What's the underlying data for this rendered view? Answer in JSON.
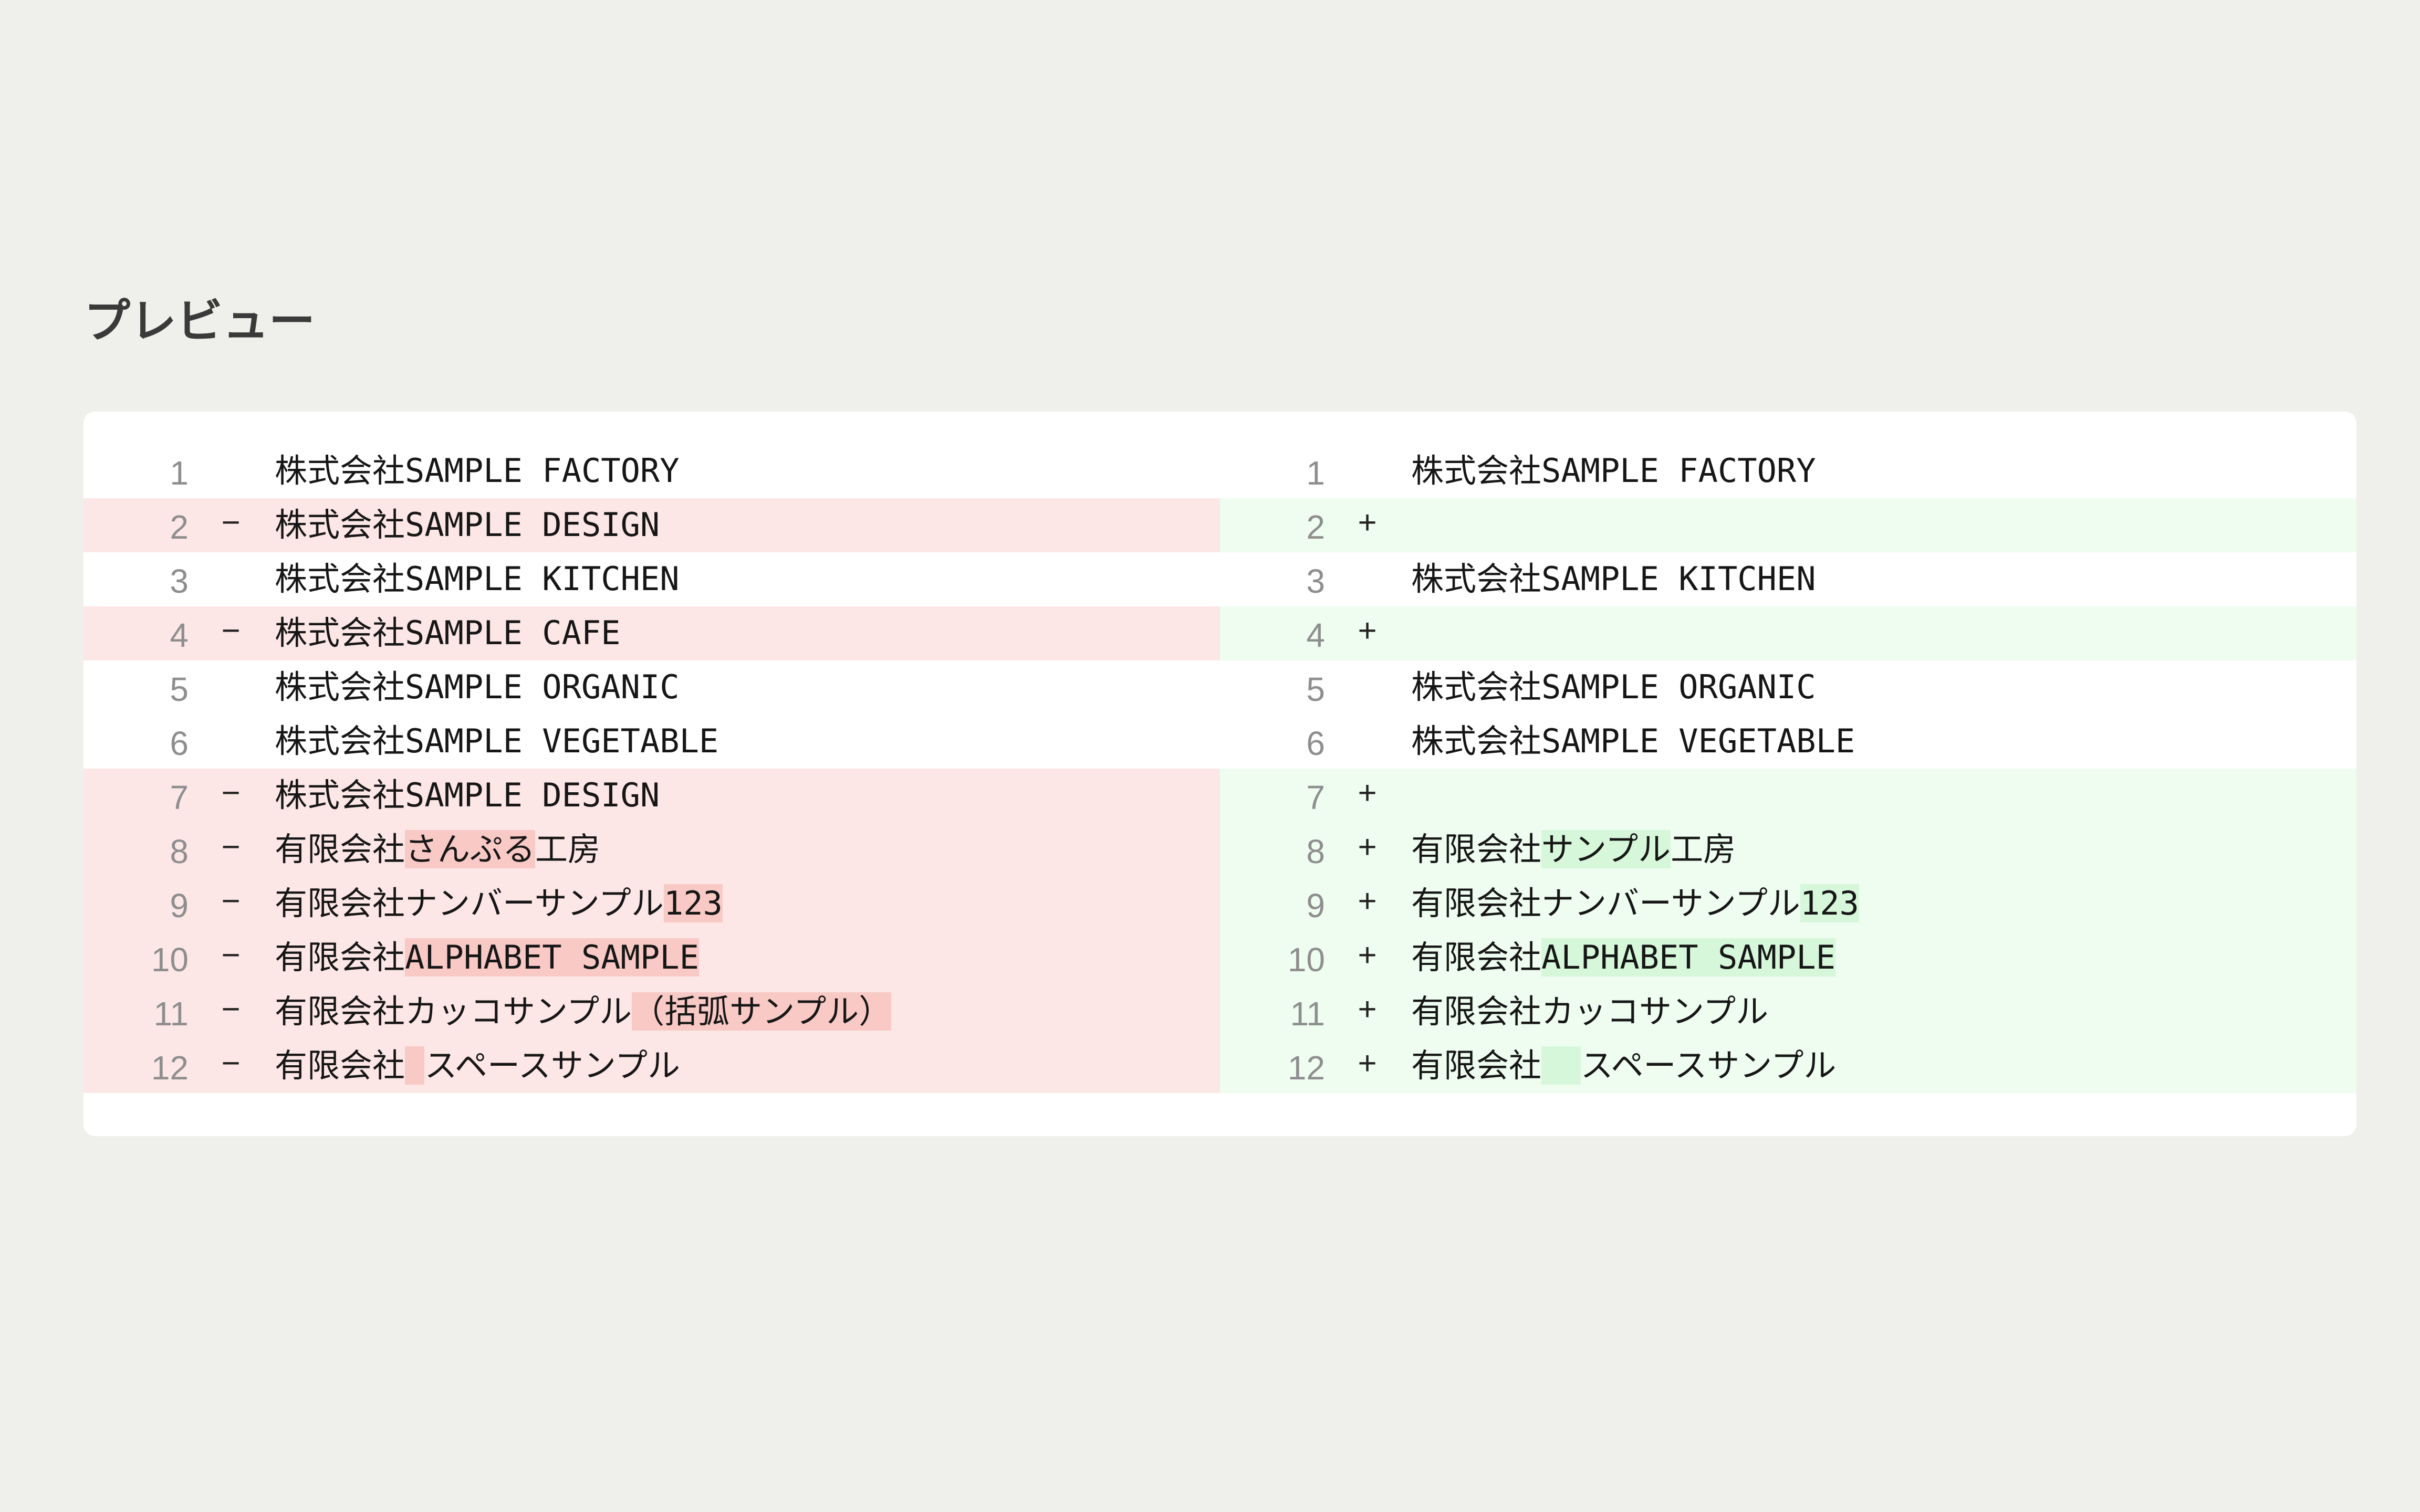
{
  "page": {
    "title": "プレビュー"
  },
  "colors": {
    "background": "#efefeb",
    "card": "#ffffff",
    "removed_row": "#fde7e6",
    "removed_highlight": "#f8c9c5",
    "added_row": "#eefdf0",
    "added_highlight": "#d6f7da",
    "line_number": "#8e8e8e"
  },
  "diff": {
    "left": [
      {
        "num": "1",
        "marker": "",
        "type": "same",
        "segments": [
          {
            "text": "株式会社SAMPLE FACTORY",
            "hl": false
          }
        ]
      },
      {
        "num": "2",
        "marker": "−",
        "type": "del",
        "segments": [
          {
            "text": "株式会社SAMPLE DESIGN",
            "hl": false
          }
        ]
      },
      {
        "num": "3",
        "marker": "",
        "type": "same",
        "segments": [
          {
            "text": "株式会社SAMPLE KITCHEN",
            "hl": false
          }
        ]
      },
      {
        "num": "4",
        "marker": "−",
        "type": "del",
        "segments": [
          {
            "text": "株式会社SAMPLE CAFE",
            "hl": false
          }
        ]
      },
      {
        "num": "5",
        "marker": "",
        "type": "same",
        "segments": [
          {
            "text": "株式会社SAMPLE ORGANIC",
            "hl": false
          }
        ]
      },
      {
        "num": "6",
        "marker": "",
        "type": "same",
        "segments": [
          {
            "text": "株式会社SAMPLE VEGETABLE",
            "hl": false
          }
        ]
      },
      {
        "num": "7",
        "marker": "−",
        "type": "del",
        "segments": [
          {
            "text": "株式会社SAMPLE DESIGN",
            "hl": false
          }
        ]
      },
      {
        "num": "8",
        "marker": "−",
        "type": "del",
        "segments": [
          {
            "text": "有限会社",
            "hl": false
          },
          {
            "text": "さんぷる",
            "hl": true
          },
          {
            "text": "工房",
            "hl": false
          }
        ]
      },
      {
        "num": "9",
        "marker": "−",
        "type": "del",
        "segments": [
          {
            "text": "有限会社ナンバーサンプル",
            "hl": false
          },
          {
            "text": "123",
            "hl": true
          }
        ]
      },
      {
        "num": "10",
        "marker": "−",
        "type": "del",
        "segments": [
          {
            "text": "有限会社",
            "hl": false
          },
          {
            "text": "ALPHABET SAMPLE",
            "hl": true
          }
        ]
      },
      {
        "num": "11",
        "marker": "−",
        "type": "del",
        "segments": [
          {
            "text": "有限会社カッコサンプル",
            "hl": false
          },
          {
            "text": "（括弧サンプル）",
            "hl": true
          }
        ]
      },
      {
        "num": "12",
        "marker": "−",
        "type": "del",
        "segments": [
          {
            "text": "有限会社",
            "hl": false
          },
          {
            "text": " ",
            "hl": true
          },
          {
            "text": "スペースサンプル",
            "hl": false
          }
        ]
      }
    ],
    "right": [
      {
        "num": "1",
        "marker": "",
        "type": "same",
        "segments": [
          {
            "text": "株式会社SAMPLE FACTORY",
            "hl": false
          }
        ]
      },
      {
        "num": "2",
        "marker": "+",
        "type": "add",
        "segments": []
      },
      {
        "num": "3",
        "marker": "",
        "type": "same",
        "segments": [
          {
            "text": "株式会社SAMPLE KITCHEN",
            "hl": false
          }
        ]
      },
      {
        "num": "4",
        "marker": "+",
        "type": "add",
        "segments": []
      },
      {
        "num": "5",
        "marker": "",
        "type": "same",
        "segments": [
          {
            "text": "株式会社SAMPLE ORGANIC",
            "hl": false
          }
        ]
      },
      {
        "num": "6",
        "marker": "",
        "type": "same",
        "segments": [
          {
            "text": "株式会社SAMPLE VEGETABLE",
            "hl": false
          }
        ]
      },
      {
        "num": "7",
        "marker": "+",
        "type": "add",
        "segments": []
      },
      {
        "num": "8",
        "marker": "+",
        "type": "add",
        "segments": [
          {
            "text": "有限会社",
            "hl": false
          },
          {
            "text": "サンプル",
            "hl": true
          },
          {
            "text": "工房",
            "hl": false
          }
        ]
      },
      {
        "num": "9",
        "marker": "+",
        "type": "add",
        "segments": [
          {
            "text": "有限会社ナンバーサンプル",
            "hl": false
          },
          {
            "text": "123",
            "hl": true
          }
        ]
      },
      {
        "num": "10",
        "marker": "+",
        "type": "add",
        "segments": [
          {
            "text": "有限会社",
            "hl": false
          },
          {
            "text": "ALPHABET SAMPLE",
            "hl": true
          }
        ]
      },
      {
        "num": "11",
        "marker": "+",
        "type": "add",
        "segments": [
          {
            "text": "有限会社カッコサンプル",
            "hl": false
          }
        ]
      },
      {
        "num": "12",
        "marker": "+",
        "type": "add",
        "segments": [
          {
            "text": "有限会社",
            "hl": false
          },
          {
            "text": "  ",
            "hl": true
          },
          {
            "text": "スペースサンプル",
            "hl": false
          }
        ]
      }
    ]
  }
}
